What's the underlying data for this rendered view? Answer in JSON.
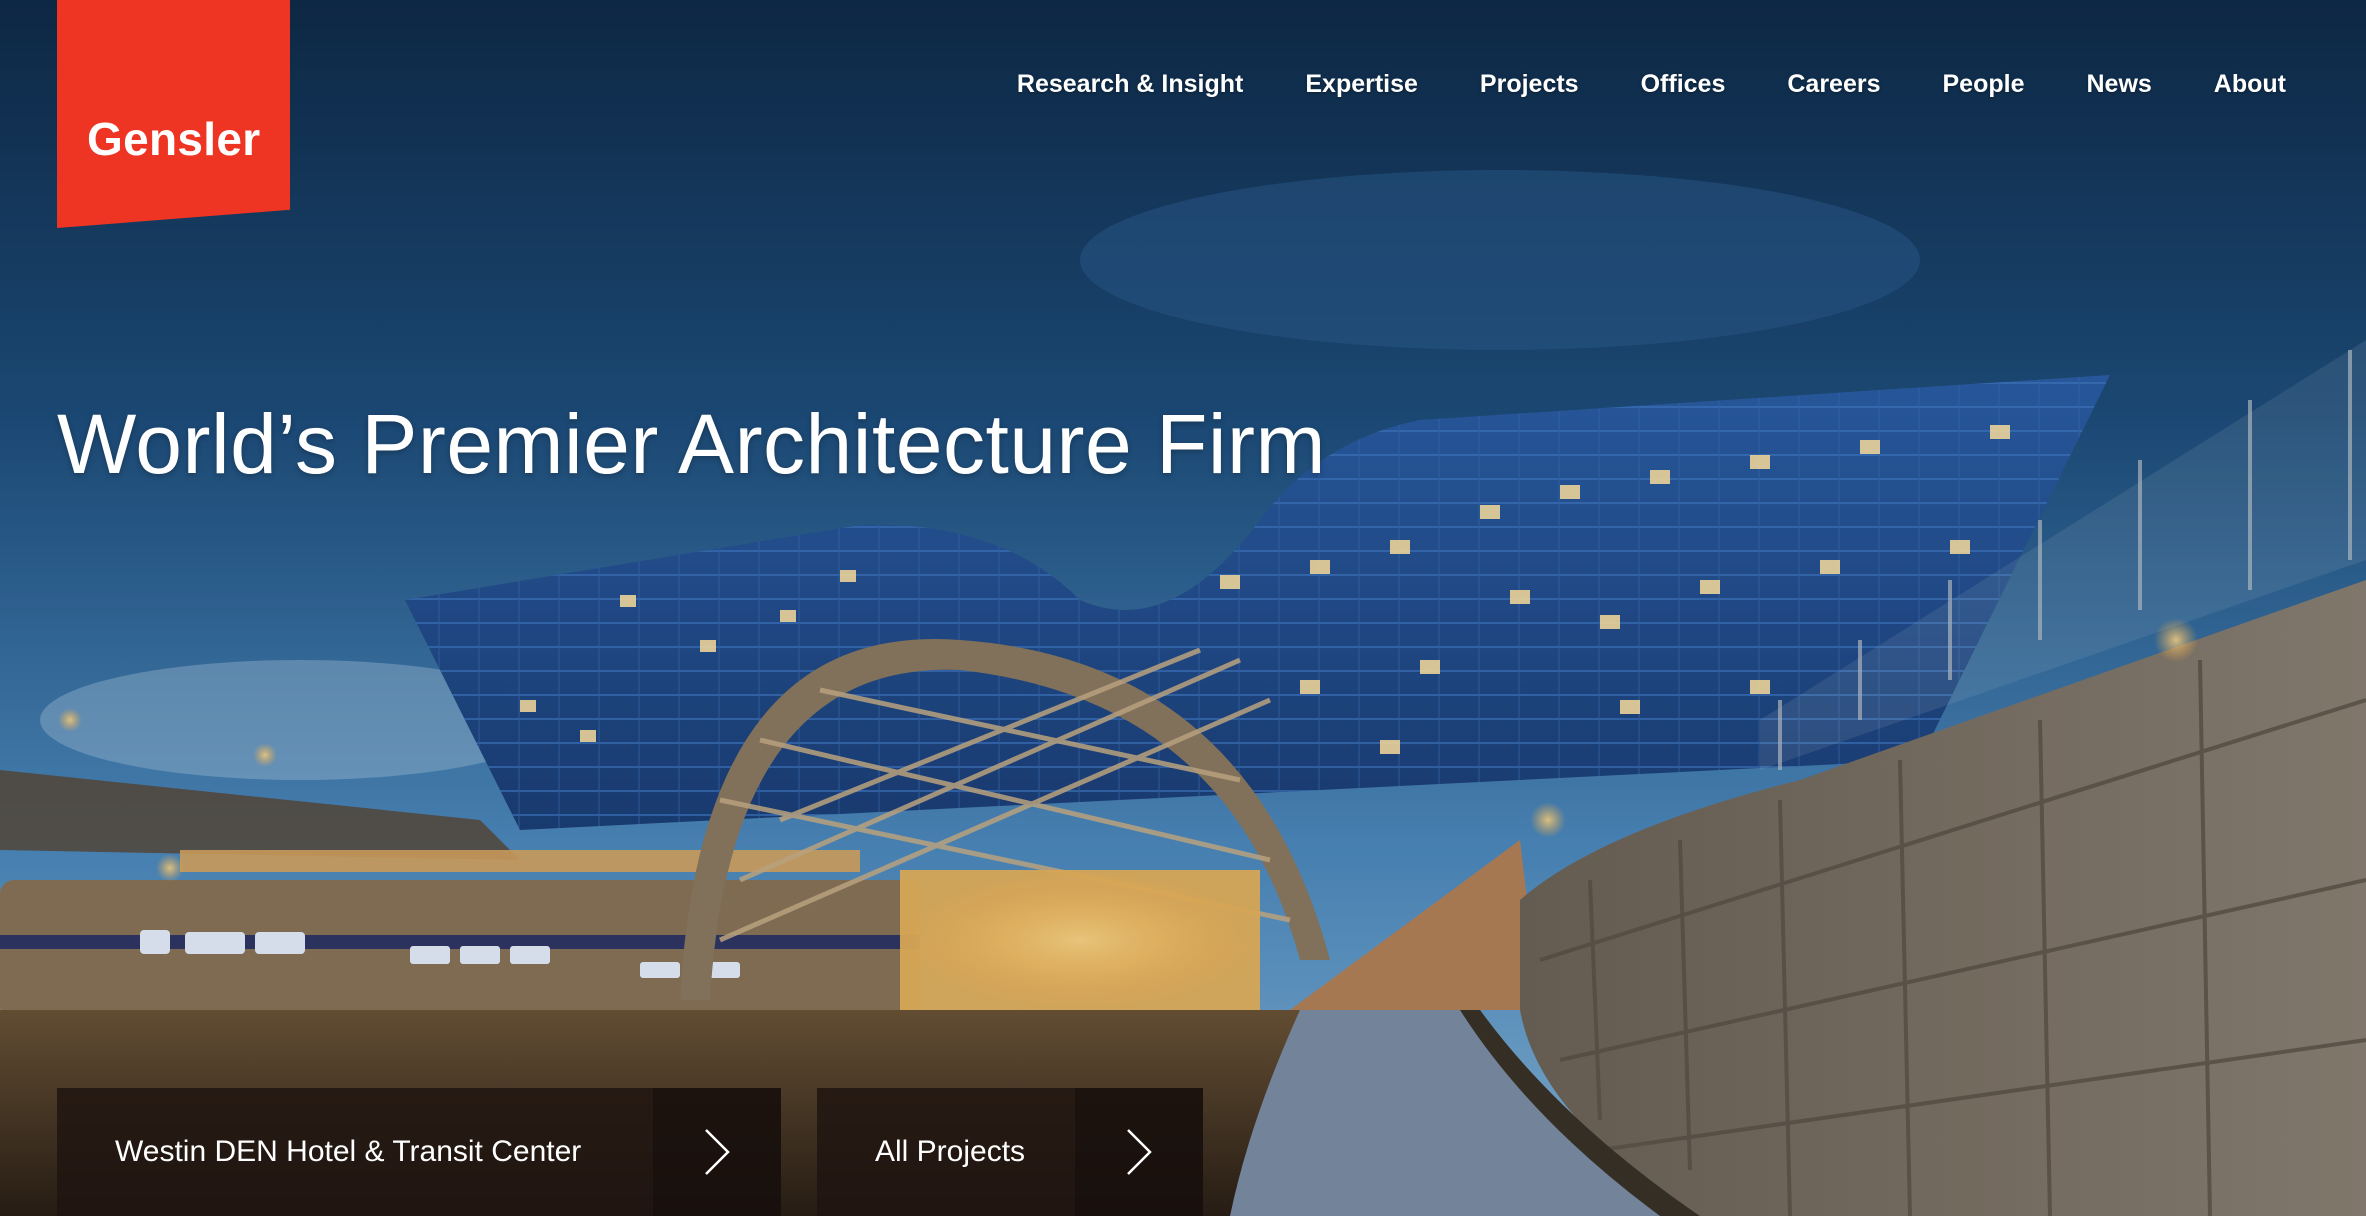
{
  "brand": {
    "logo_text": "Gensler",
    "accent_color": "#ee3524"
  },
  "nav": {
    "items": [
      "Research & Insight",
      "Expertise",
      "Projects",
      "Offices",
      "Careers",
      "People",
      "News",
      "About"
    ]
  },
  "hero": {
    "headline": "World’s Premier Architecture Firm",
    "cta_project": "Westin DEN Hotel & Transit Center",
    "cta_all": "All Projects"
  }
}
